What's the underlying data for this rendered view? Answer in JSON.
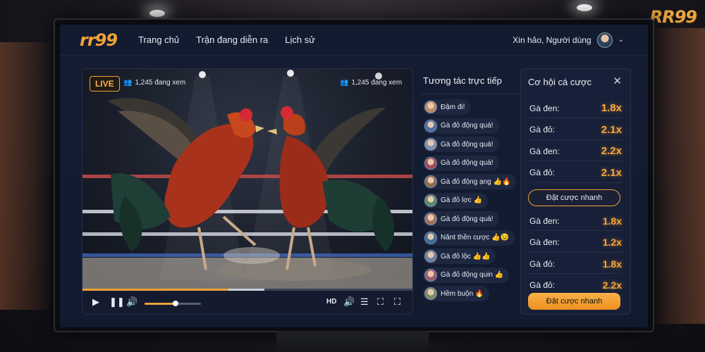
{
  "corner_logo": "RR99",
  "nav": {
    "brand": "rr99",
    "links": [
      "Trang chủ",
      "Trận đang diễn ra",
      "Lịch sử"
    ],
    "user_greeting": "Xin hảo, Người dùng"
  },
  "video": {
    "live_label": "LIVE",
    "viewers_left": "1,245 đang xem",
    "viewers_right": "1,245 đang xem",
    "quality": "HD",
    "progress": 0.44,
    "buffered": 0.55,
    "volume": 0.55
  },
  "chat": {
    "title": "Tương tác trực tiếp",
    "messages": [
      {
        "text": "Đậm đi!",
        "avatar_color": "#b88a6a"
      },
      {
        "text": "Gà đỏ động quá!",
        "avatar_color": "#4a6fa8"
      },
      {
        "text": "Gà đỏ động quá!",
        "avatar_color": "#7c91b0"
      },
      {
        "text": "Gà đỏ động quá!",
        "avatar_color": "#a24a5a"
      },
      {
        "text": "Gà đỏ động ạng 👍🔥",
        "avatar_color": "#8b6b55"
      },
      {
        "text": "Gà đỏ lợc 👍",
        "avatar_color": "#5a8a6a"
      },
      {
        "text": "Gà đỏ động quá!",
        "avatar_color": "#a0705a"
      },
      {
        "text": "Nânt thền cược 👍😉",
        "avatar_color": "#3f6e9a"
      },
      {
        "text": "Gà đỏ lộc 👍👍",
        "avatar_color": "#6c7f9e"
      },
      {
        "text": "Gà đỏ động quin 👍",
        "avatar_color": "#9a5a70"
      },
      {
        "text": "Hềm buộn 🔥",
        "avatar_color": "#7a8a6a"
      }
    ]
  },
  "odds": {
    "title": "Cơ hội cá cược",
    "top_rows": [
      {
        "label": "Gà đen:",
        "value": "1.8x"
      },
      {
        "label": "Gà đỏ:",
        "value": "2.1x"
      },
      {
        "label": "Gà đen:",
        "value": "2.2x"
      },
      {
        "label": "Gà đỏ:",
        "value": "2.1x"
      }
    ],
    "quick_bet_label": "Đặt cược nhanh",
    "bottom_rows": [
      {
        "label": "Gà đen:",
        "value": "1.8x"
      },
      {
        "label": "Gà đen:",
        "value": "1.2x"
      },
      {
        "label": "Gà đỏ:",
        "value": "1.8x"
      },
      {
        "label": "Gà đỏ:",
        "value": "2.2x"
      }
    ],
    "quick_bet_label_2": "Đặt cược nhanh"
  },
  "colors": {
    "accent": "#f0a237",
    "panel": "#172038",
    "bg": "#111a2e"
  }
}
